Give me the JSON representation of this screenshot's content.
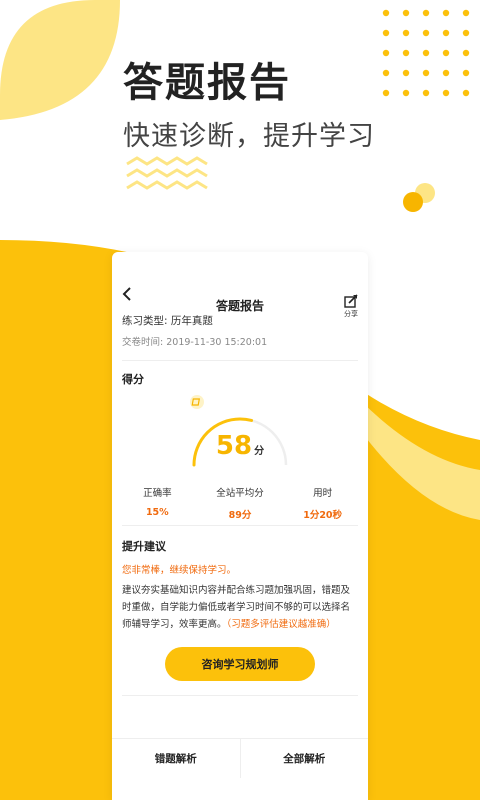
{
  "hero": {
    "title": "答题报告",
    "subtitle": "快速诊断，提升学习"
  },
  "nav": {
    "title": "答题报告",
    "share_label": "分享"
  },
  "info": {
    "type_label": "练习类型:",
    "type_value": "历年真题",
    "time_label": "交卷时间:",
    "time_value": "2019-11-30 15:20:01"
  },
  "score": {
    "heading": "得分",
    "value": "58",
    "unit": "分",
    "fraction": 0.58
  },
  "stats": [
    {
      "label": "正确率",
      "value": "15%"
    },
    {
      "label": "全站平均分",
      "value": "89分"
    },
    {
      "label": "用时",
      "value": "1分20秒"
    }
  ],
  "advice": {
    "heading": "提升建议",
    "praise": "您非常棒，继续保持学习。",
    "body": "建议夯实基础知识内容并配合练习题加强巩固，错题及时重做，自学能力偏低或者学习时间不够的可以选择名师辅导学习，效率更高。",
    "note": "（习题多评估建议越准确）"
  },
  "consult_button": "咨询学习规划师",
  "bottom": {
    "wrong_analysis": "错题解析",
    "all_analysis": "全部解析"
  },
  "colors": {
    "accent": "#fcc10b",
    "light_accent": "#fde585",
    "highlight": "#f06a0e"
  }
}
